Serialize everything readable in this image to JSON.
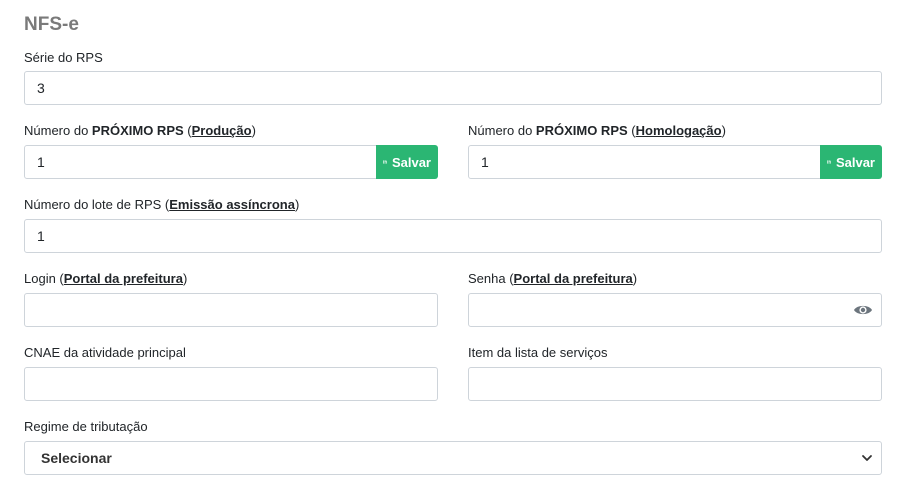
{
  "section_title": "NFS-e",
  "serie": {
    "label": "Série do RPS",
    "value": "3"
  },
  "proximo_producao": {
    "label_pre": "Número do ",
    "label_bold": "PRÓXIMO RPS",
    "label_open": " (",
    "label_link": "Produção",
    "label_close": ")",
    "value": "1",
    "button": "Salvar"
  },
  "proximo_homologacao": {
    "label_pre": "Número do ",
    "label_bold": "PRÓXIMO RPS",
    "label_open": " (",
    "label_link": "Homologação",
    "label_close": ")",
    "value": "1",
    "button": "Salvar"
  },
  "lote": {
    "label_pre": "Número do lote de RPS (",
    "label_link": "Emissão assíncrona",
    "label_close": ")",
    "value": "1"
  },
  "login": {
    "label_pre": "Login (",
    "label_link": "Portal da prefeitura",
    "label_close": ")",
    "value": ""
  },
  "senha": {
    "label_pre": "Senha (",
    "label_link": "Portal da prefeitura",
    "label_close": ")",
    "value": "",
    "icon": "eye-icon"
  },
  "cnae": {
    "label": "CNAE da atividade principal",
    "value": ""
  },
  "item_servicos": {
    "label": "Item da lista de serviços",
    "value": ""
  },
  "regime": {
    "label": "Regime de tributação",
    "selected": "Selecionar"
  },
  "colors": {
    "save_button": "#2bb673",
    "title": "#7a7a7a",
    "border": "#ced4da"
  }
}
